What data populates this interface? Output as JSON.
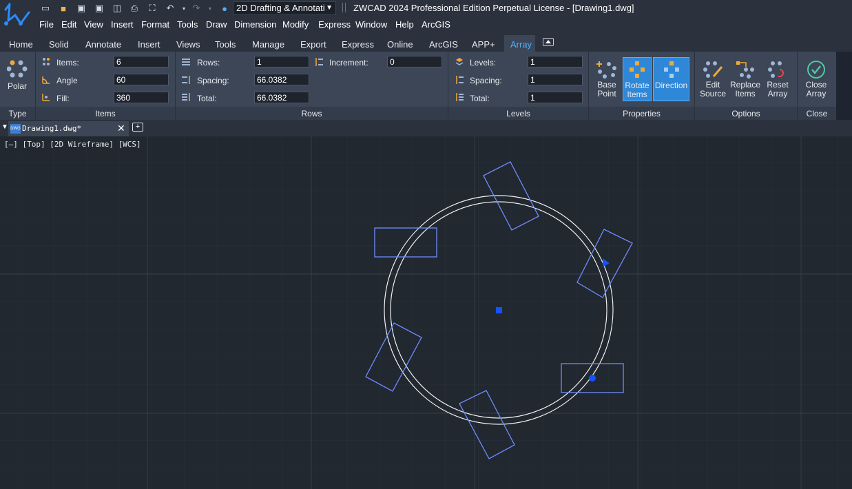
{
  "app": {
    "title": "ZWCAD 2024 Professional Edition Perpetual License - [Drawing1.dwg]",
    "workspace": "2D Drafting & Annotati"
  },
  "quick_access": [
    "new-icon",
    "open-icon",
    "save-icon",
    "save-as-icon",
    "plot-preview-icon",
    "print-icon",
    "zoom-extents-icon",
    "undo-icon",
    "redo-icon",
    "help-icon"
  ],
  "menu": [
    "File",
    "Edit",
    "View",
    "Insert",
    "Format",
    "Tools",
    "Draw",
    "Dimension",
    "Modify",
    "Express",
    "Window",
    "Help",
    "ArcGIS"
  ],
  "ribbon_tabs": [
    "Home",
    "Solid",
    "Annotate",
    "Insert",
    "Views",
    "Tools",
    "Manage",
    "Export",
    "Express",
    "Online",
    "ArcGIS",
    "APP+",
    "Array"
  ],
  "active_tab": "Array",
  "ribbon": {
    "type": {
      "polar_label": "Polar",
      "footer": "Type"
    },
    "items": {
      "footer": "Items",
      "items_label": "Items:",
      "items_value": "6",
      "angle_label": "Angle",
      "angle_value": "60",
      "fill_label": "Fill:",
      "fill_value": "360"
    },
    "rows": {
      "footer": "Rows",
      "rows_label": "Rows:",
      "rows_value": "1",
      "spacing_label": "Spacing:",
      "spacing_value": "66.0382",
      "total_label": "Total:",
      "total_value": "66.0382",
      "increment_label": "Increment:",
      "increment_value": "0"
    },
    "levels": {
      "footer": "Levels",
      "levels_label": "Levels:",
      "levels_value": "1",
      "spacing_label": "Spacing:",
      "spacing_value": "1",
      "total_label": "Total:",
      "total_value": "1"
    },
    "properties": {
      "footer": "Properties",
      "base_point_l1": "Base",
      "base_point_l2": "Point",
      "rotate_items_l1": "Rotate",
      "rotate_items_l2": "Items",
      "direction": "Direction"
    },
    "options": {
      "footer": "Options",
      "edit_source_l1": "Edit",
      "edit_source_l2": "Source",
      "replace_items_l1": "Replace",
      "replace_items_l2": "Items",
      "reset_array_l1": "Reset",
      "reset_array_l2": "Array"
    },
    "close": {
      "footer": "Close",
      "close_array_l1": "Close",
      "close_array_l2": "Array"
    }
  },
  "document": {
    "tab_label": "Drawing1.dwg*"
  },
  "viewport": {
    "label": "[—] [Top] [2D Wireframe] [WCS]"
  },
  "colors": {
    "accent": "#4fb0ff",
    "active_button": "#2f87d8",
    "drawing_geometry": "#6f8cff",
    "grip": "#1552ff"
  }
}
